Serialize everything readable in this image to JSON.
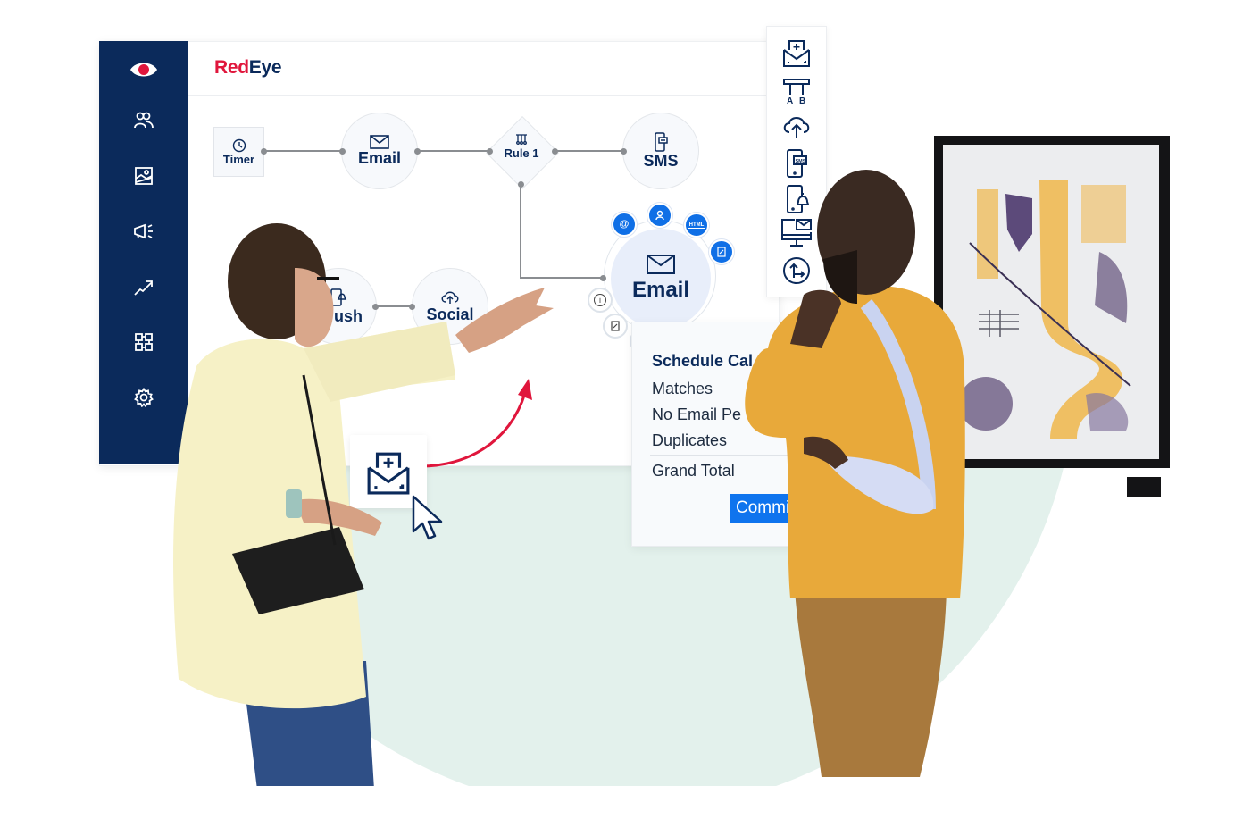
{
  "brand": {
    "name_part1": "Red",
    "name_part2": "Eye",
    "colors": {
      "primary_navy": "#0b2a5b",
      "brand_red": "#e0163c",
      "accent_blue": "#0f6fe6",
      "backdrop_mint": "#e3f1ec"
    }
  },
  "sidebar": {
    "items": [
      {
        "icon": "eye-logo-icon"
      },
      {
        "icon": "users-icon"
      },
      {
        "icon": "image-template-icon"
      },
      {
        "icon": "megaphone-icon"
      },
      {
        "icon": "trend-arrow-icon"
      },
      {
        "icon": "automation-blocks-icon"
      },
      {
        "icon": "gear-icon"
      }
    ]
  },
  "workflow": {
    "nodes": [
      {
        "id": "timer",
        "label": "Timer",
        "icon": "clock-icon"
      },
      {
        "id": "email-1",
        "label": "Email",
        "icon": "envelope-icon"
      },
      {
        "id": "rule-1",
        "label": "Rule 1",
        "icon": "split-rule-icon"
      },
      {
        "id": "sms",
        "label": "SMS",
        "icon": "phone-sms-icon"
      },
      {
        "id": "push",
        "label": "Push",
        "visible_label": "ush",
        "icon": "phone-bell-icon"
      },
      {
        "id": "social",
        "label": "Social",
        "icon": "cloud-upload-icon"
      },
      {
        "id": "email-selected",
        "label": "Email",
        "icon": "envelope-icon"
      }
    ],
    "selected_node_actions": [
      {
        "icon": "at-sign-icon",
        "label": "@"
      },
      {
        "icon": "person-icon"
      },
      {
        "icon": "html-icon",
        "label": "HTML"
      },
      {
        "icon": "edit-doc-icon"
      },
      {
        "icon": "info-icon",
        "label": "i"
      },
      {
        "icon": "note-icon"
      },
      {
        "icon": "gear-icon"
      }
    ]
  },
  "toolbar": {
    "tools": [
      {
        "icon": "add-email-icon"
      },
      {
        "icon": "ab-split-icon",
        "label": "A B"
      },
      {
        "icon": "cloud-upload-icon"
      },
      {
        "icon": "sms-phone-icon",
        "label": "SMS"
      },
      {
        "icon": "push-phone-icon"
      },
      {
        "icon": "desktop-email-icon"
      },
      {
        "icon": "move-arrows-icon"
      }
    ]
  },
  "summary_panel": {
    "title": "Schedule Cal",
    "rows": [
      "Matches",
      "No Email Pe",
      "Duplicates"
    ],
    "total_label": "Grand Total",
    "commit_label": "Commis"
  },
  "drag_hint": {
    "icon": "add-email-icon",
    "cursor": "mouse-pointer-icon",
    "arrow_color": "#e0163c"
  }
}
